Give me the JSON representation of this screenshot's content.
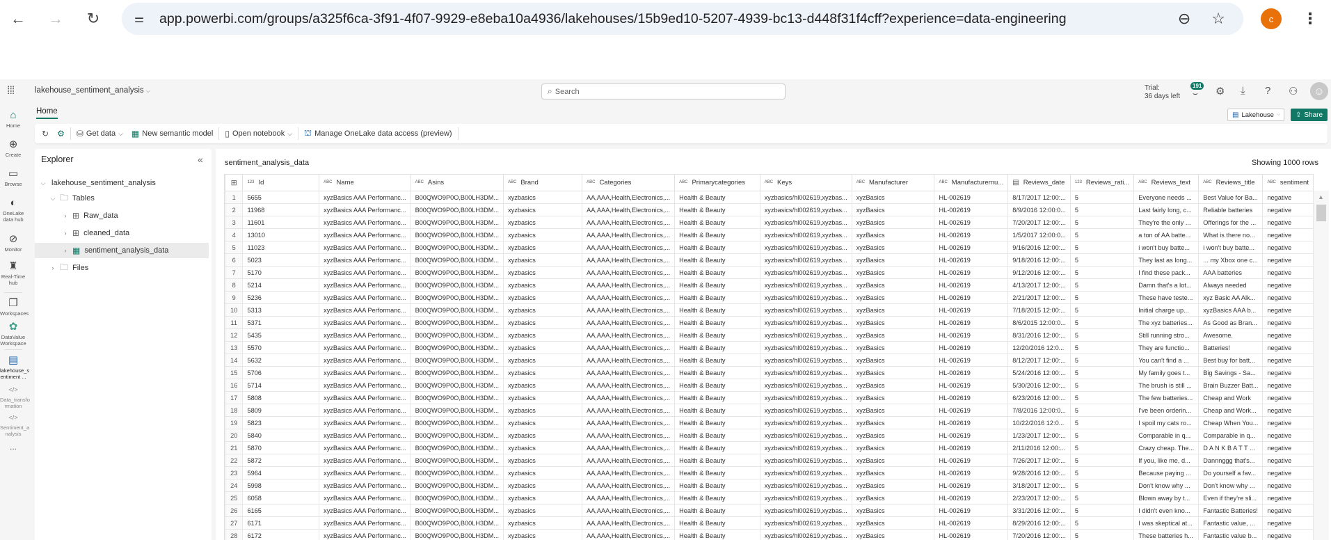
{
  "browser": {
    "url": "app.powerbi.com/groups/a325f6ca-3f91-4f07-9929-e8eba10a4936/lakehouses/15b9ed10-5207-4939-bc13-d448f31f4cff?experience=data-engineering",
    "profile_initial": "c",
    "icons": {
      "back": "←",
      "forward": "→",
      "reload": "↻",
      "site_info": "⚙",
      "zoom": "🔍︎",
      "star": "☆",
      "menu": "⋮"
    }
  },
  "topbar": {
    "workspace_name": "lakehouse_sentiment_analysis",
    "search_placeholder": "Search",
    "trial_line1": "Trial:",
    "trial_line2": "36 days left",
    "notification_count": "191"
  },
  "rail": [
    {
      "label": "Home",
      "icon": "⌂"
    },
    {
      "label": "Create",
      "icon": "⊕"
    },
    {
      "label": "Browse",
      "icon": "🗀"
    },
    {
      "label": "OneLake data hub",
      "icon": "◐"
    },
    {
      "label": "Monitor",
      "icon": "⊘"
    },
    {
      "label": "Real-Time hub",
      "icon": "♜"
    },
    {
      "label": "Workspaces",
      "icon": "❐"
    },
    {
      "label": "DataValue Workspace",
      "icon": "✿"
    },
    {
      "label": "lakehouse_s entiment ...",
      "icon": "▤"
    },
    {
      "label": "Data_transfo rmation",
      "icon": "</>"
    },
    {
      "label": "Sentiment_a nalysis",
      "icon": "</>"
    },
    {
      "label": "...",
      "icon": ""
    }
  ],
  "ribbon": {
    "home_tab": "Home",
    "get_data": "Get data",
    "new_semantic_model": "New semantic model",
    "open_notebook": "Open notebook",
    "manage_access": "Manage OneLake data access (preview)",
    "lakehouse_dropdown": "Lakehouse",
    "share": "Share"
  },
  "explorer": {
    "title": "Explorer",
    "root": "lakehouse_sentiment_analysis",
    "tables_folder": "Tables",
    "tables": [
      "Raw_data",
      "cleaned_data",
      "sentiment_analysis_data"
    ],
    "files_folder": "Files"
  },
  "table": {
    "name": "sentiment_analysis_data",
    "row_count_label": "Showing 1000 rows",
    "columns": [
      {
        "type": "123",
        "name": "Id"
      },
      {
        "type": "ABC",
        "name": "Name"
      },
      {
        "type": "ABC",
        "name": "Asins"
      },
      {
        "type": "ABC",
        "name": "Brand"
      },
      {
        "type": "ABC",
        "name": "Categories"
      },
      {
        "type": "ABC",
        "name": "Primarycategories"
      },
      {
        "type": "ABC",
        "name": "Keys"
      },
      {
        "type": "ABC",
        "name": "Manufacturer"
      },
      {
        "type": "ABC",
        "name": "Manufacturernu..."
      },
      {
        "type": "date",
        "name": "Reviews_date"
      },
      {
        "type": "123",
        "name": "Reviews_rati..."
      },
      {
        "type": "ABC",
        "name": "Reviews_text"
      },
      {
        "type": "ABC",
        "name": "Reviews_title"
      },
      {
        "type": "ABC",
        "name": "sentiment"
      }
    ],
    "common": {
      "name": "xyzBasics AAA Performanc...",
      "asins": "B00QWO9P0O,B00LH3DM...",
      "brand": "xyzbasics",
      "categories": "AA,AAA,Health,Electronics,...",
      "primary": "Health & Beauty",
      "keys": "xyzbasics/hl002619,xyzbas...",
      "manufacturer": "xyzBasics",
      "mfr_number": "HL-002619",
      "rating": "5",
      "sentiment": "negative"
    },
    "rows": [
      {
        "n": "1",
        "id": "5655",
        "date": "8/17/2017 12:00:...",
        "text": "Everyone needs ...",
        "title": "Best Value for Ba..."
      },
      {
        "n": "2",
        "id": "11968",
        "date": "8/9/2016 12:00:0...",
        "text": "Last fairly long, c...",
        "title": "Reliable batteries"
      },
      {
        "n": "3",
        "id": "11601",
        "date": "7/20/2017 12:00:...",
        "text": "They're the only ...",
        "title": "Offerings for the ..."
      },
      {
        "n": "4",
        "id": "13010",
        "date": "1/5/2017 12:00:0...",
        "text": "a ton of AA batte...",
        "title": "What is there no..."
      },
      {
        "n": "5",
        "id": "11023",
        "date": "9/16/2016 12:00:...",
        "text": "i won't buy batte...",
        "title": "i won't buy batte..."
      },
      {
        "n": "6",
        "id": "5023",
        "date": "9/18/2016 12:00:...",
        "text": "They last as long...",
        "title": "... my Xbox one c..."
      },
      {
        "n": "7",
        "id": "5170",
        "date": "9/12/2016 12:00:...",
        "text": "I find these pack...",
        "title": "AAA batteries"
      },
      {
        "n": "8",
        "id": "5214",
        "date": "4/13/2017 12:00:...",
        "text": "Damn that's a lot...",
        "title": "Always needed"
      },
      {
        "n": "9",
        "id": "5236",
        "date": "2/21/2017 12:00:...",
        "text": "These have teste...",
        "title": "xyz Basic AA Alk..."
      },
      {
        "n": "10",
        "id": "5313",
        "date": "7/18/2015 12:00:...",
        "text": "Initial charge up...",
        "title": "xyzBasics AAA b..."
      },
      {
        "n": "11",
        "id": "5371",
        "date": "8/6/2015 12:00:0...",
        "text": "The xyz batteries...",
        "title": "As Good as Bran..."
      },
      {
        "n": "12",
        "id": "5435",
        "date": "8/31/2016 12:00:...",
        "text": "Still running stro...",
        "title": "Awesome."
      },
      {
        "n": "13",
        "id": "5570",
        "date": "12/20/2016 12:0...",
        "text": "They are functio...",
        "title": "Batteries!"
      },
      {
        "n": "14",
        "id": "5632",
        "date": "8/12/2017 12:00:...",
        "text": "You can't find a ...",
        "title": "Best buy for batt..."
      },
      {
        "n": "15",
        "id": "5706",
        "date": "5/24/2016 12:00:...",
        "text": "My family goes t...",
        "title": "Big Savings - Sa..."
      },
      {
        "n": "16",
        "id": "5714",
        "date": "5/30/2016 12:00:...",
        "text": "The brush is still ...",
        "title": "Brain Buzzer Batt..."
      },
      {
        "n": "17",
        "id": "5808",
        "date": "6/23/2016 12:00:...",
        "text": "The few batteries...",
        "title": "Cheap and Work"
      },
      {
        "n": "18",
        "id": "5809",
        "date": "7/8/2016 12:00:0...",
        "text": "I've been orderin...",
        "title": "Cheap and Work..."
      },
      {
        "n": "19",
        "id": "5823",
        "date": "10/22/2016 12:0...",
        "text": "I spoil my cats ro...",
        "title": "Cheap When You..."
      },
      {
        "n": "20",
        "id": "5840",
        "date": "1/23/2017 12:00:...",
        "text": "Comparable in q...",
        "title": "Comparable in q..."
      },
      {
        "n": "21",
        "id": "5870",
        "date": "2/11/2016 12:00:...",
        "text": "Crazy cheap. The...",
        "title": "D A N K B A T T ..."
      },
      {
        "n": "22",
        "id": "5872",
        "date": "7/26/2017 12:00:...",
        "text": "If you, like me, d...",
        "title": "Dannnggg that's..."
      },
      {
        "n": "23",
        "id": "5964",
        "date": "9/28/2016 12:00:...",
        "text": "Because paying ...",
        "title": "Do yourself a fav..."
      },
      {
        "n": "24",
        "id": "5998",
        "date": "3/18/2017 12:00:...",
        "text": "Don't know why ...",
        "title": "Don't know why ..."
      },
      {
        "n": "25",
        "id": "6058",
        "date": "2/23/2017 12:00:...",
        "text": "Blown away by t...",
        "title": "Even if they're sli..."
      },
      {
        "n": "26",
        "id": "6165",
        "date": "3/31/2016 12:00:...",
        "text": "I didn't even kno...",
        "title": "Fantastic Batteries!"
      },
      {
        "n": "27",
        "id": "6171",
        "date": "8/29/2016 12:00:...",
        "text": "I was skeptical at...",
        "title": "Fantastic value, ..."
      },
      {
        "n": "28",
        "id": "6172",
        "date": "7/20/2016 12:00:...",
        "text": "These batteries h...",
        "title": "Fantastic value b..."
      }
    ]
  }
}
